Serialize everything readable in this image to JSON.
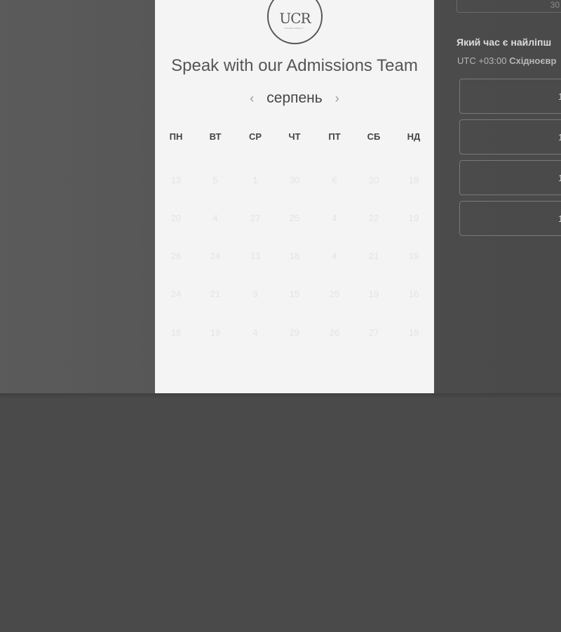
{
  "scheduler": {
    "logo_text": "UCR",
    "logo_tagline": "university college of ... ",
    "title": "Speak with our Admissions Team",
    "month": "серпень",
    "prev_icon": "chevron-left-icon",
    "next_icon": "chevron-right-icon",
    "prev_glyph": "‹",
    "next_glyph": "›",
    "weekdays": [
      "ПН",
      "ВТ",
      "СР",
      "ЧТ",
      "ПТ",
      "СБ",
      "НД"
    ],
    "weeks": [
      [
        "13",
        "5",
        "1",
        "30",
        "6",
        "20",
        "18"
      ],
      [
        "20",
        "4",
        "27",
        "25",
        "4",
        "22",
        "19"
      ],
      [
        "26",
        "24",
        "13",
        "18",
        "4",
        "21",
        "19"
      ],
      [
        "24",
        "21",
        "3",
        "15",
        "25",
        "19",
        "16"
      ],
      [
        "18",
        "19",
        "4",
        "29",
        "26",
        "27",
        "18"
      ]
    ]
  },
  "right_panel": {
    "top_field_text": "30",
    "question": "Який час є найліпш",
    "timezone_offset": "UTC +03:00",
    "timezone_name": "Східноєвр",
    "slots": [
      "1",
      "1",
      "1",
      "1"
    ]
  }
}
